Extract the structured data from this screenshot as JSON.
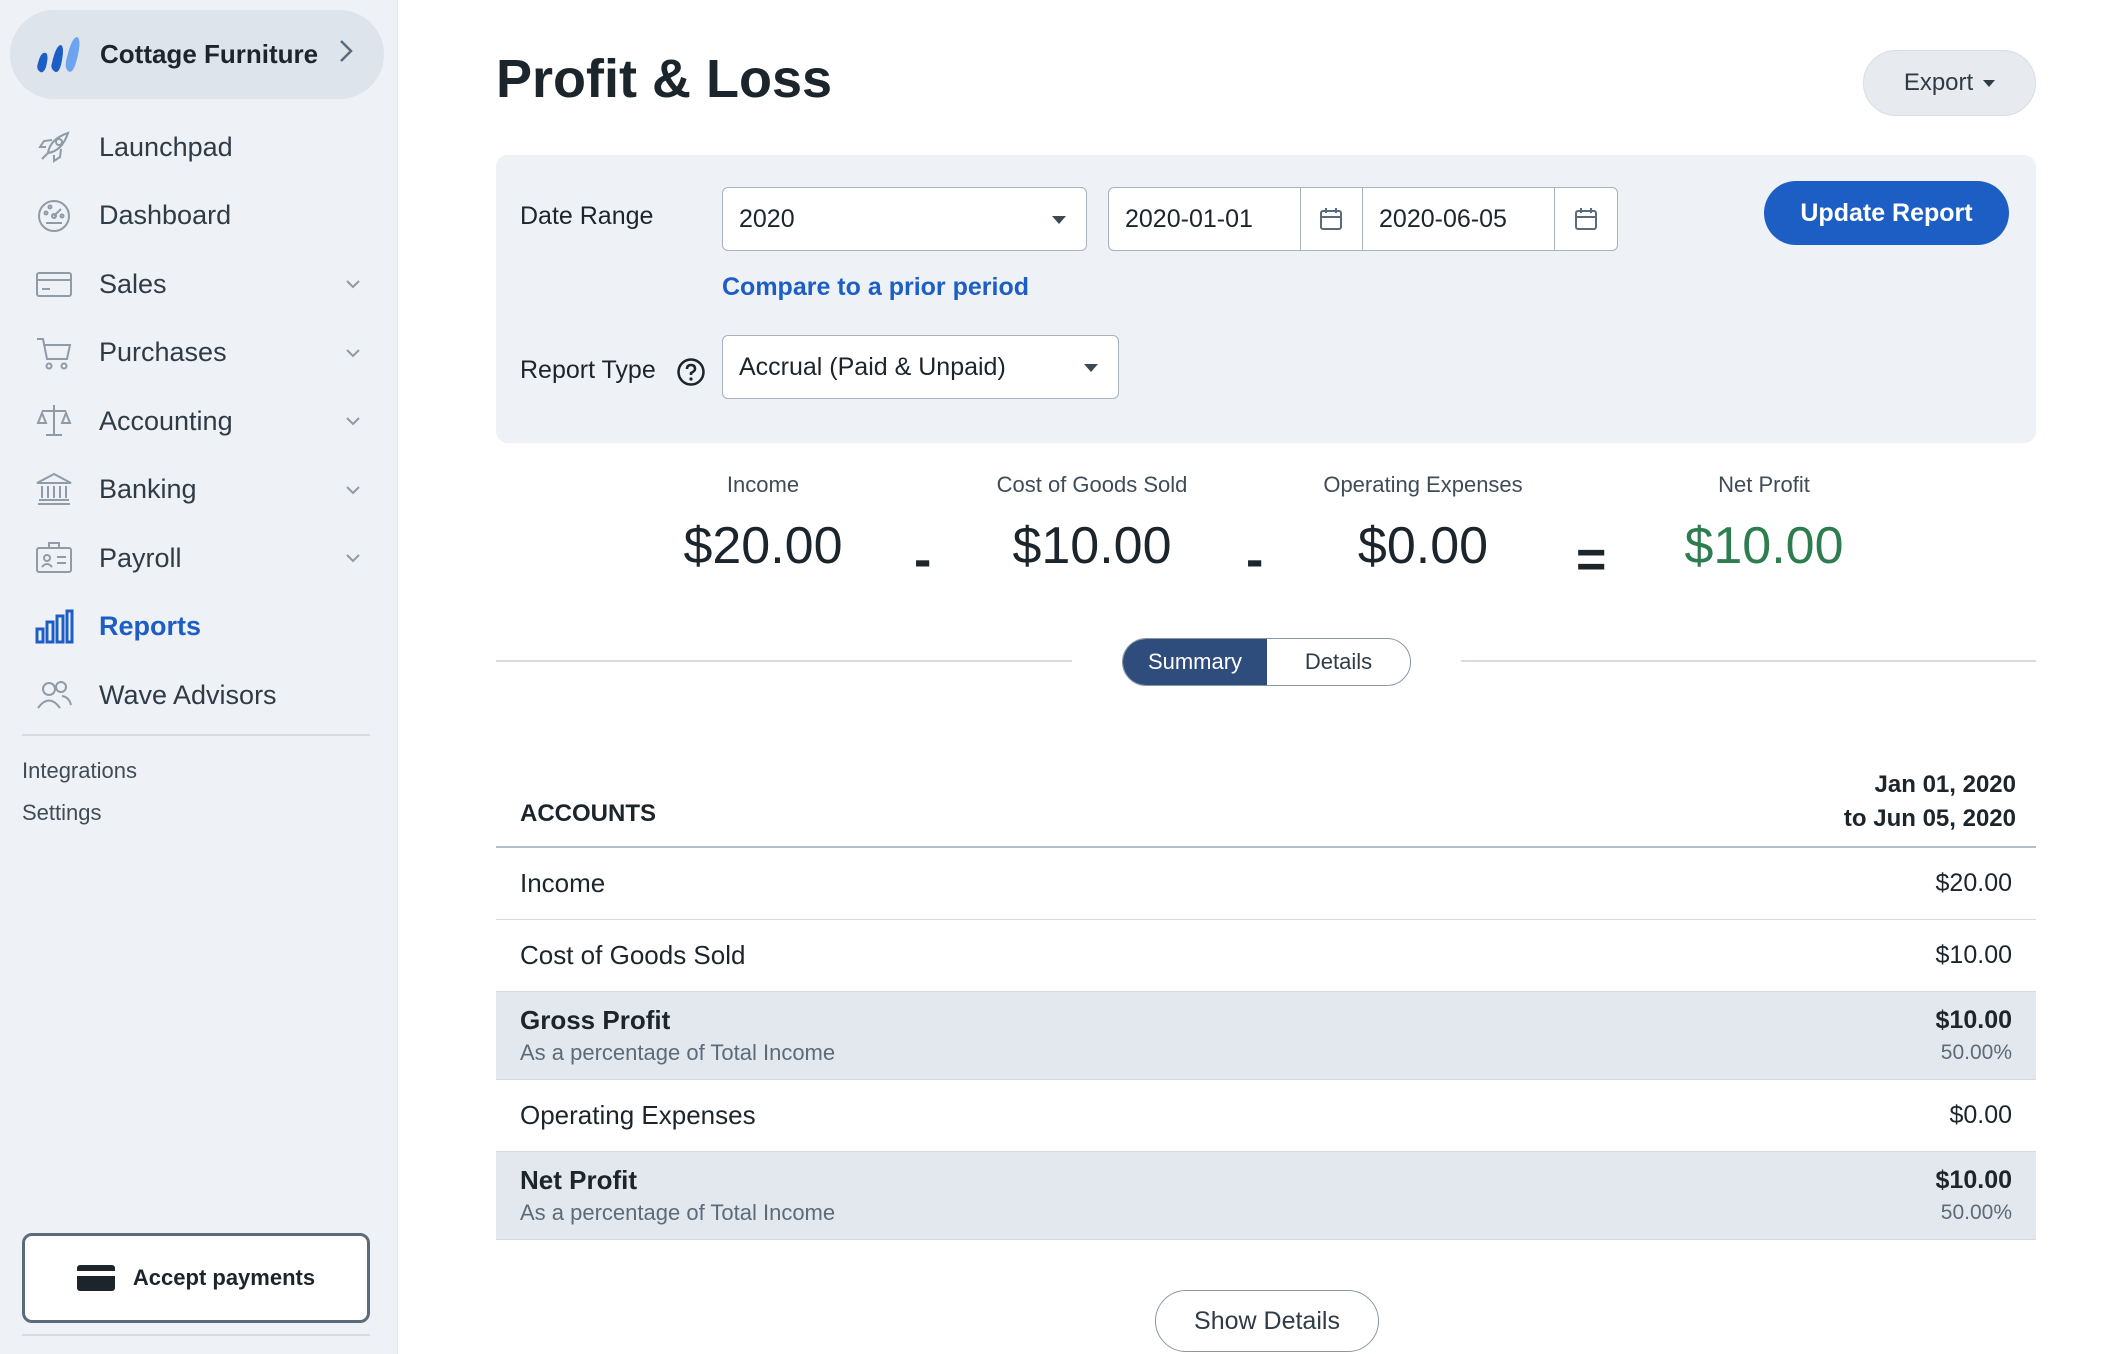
{
  "business": {
    "name": "Cottage Furniture"
  },
  "nav": {
    "items": [
      {
        "label": "Launchpad",
        "icon": "rocket-icon",
        "has_caret": false,
        "active": false
      },
      {
        "label": "Dashboard",
        "icon": "dashboard-icon",
        "has_caret": false,
        "active": false
      },
      {
        "label": "Sales",
        "icon": "sales-card-icon",
        "has_caret": true,
        "active": false
      },
      {
        "label": "Purchases",
        "icon": "cart-icon",
        "has_caret": true,
        "active": false
      },
      {
        "label": "Accounting",
        "icon": "scale-icon",
        "has_caret": true,
        "active": false
      },
      {
        "label": "Banking",
        "icon": "bank-icon",
        "has_caret": true,
        "active": false
      },
      {
        "label": "Payroll",
        "icon": "payroll-icon",
        "has_caret": true,
        "active": false
      },
      {
        "label": "Reports",
        "icon": "bar-chart-icon",
        "has_caret": false,
        "active": true
      },
      {
        "label": "Wave Advisors",
        "icon": "advisors-icon",
        "has_caret": false,
        "active": false
      }
    ],
    "sub_links": [
      "Integrations",
      "Settings"
    ],
    "accept_payments": "Accept payments"
  },
  "page": {
    "title": "Profit & Loss",
    "export_label": "Export"
  },
  "filters": {
    "date_range_label": "Date Range",
    "date_range_value": "2020",
    "start_date": "2020-01-01",
    "end_date": "2020-06-05",
    "compare_link": "Compare to a prior period",
    "report_type_label": "Report Type",
    "report_type_value": "Accrual (Paid & Unpaid)",
    "update_button": "Update Report"
  },
  "summary": {
    "income_label": "Income",
    "income_value": "$20.00",
    "cogs_label": "Cost of Goods Sold",
    "cogs_value": "$10.00",
    "opex_label": "Operating Expenses",
    "opex_value": "$0.00",
    "net_label": "Net Profit",
    "net_value": "$10.00",
    "minus": "-",
    "equals": "="
  },
  "view_toggle": {
    "summary": "Summary",
    "details": "Details",
    "selected": "Summary"
  },
  "table": {
    "accounts_header": "ACCOUNTS",
    "period_line1": "Jan 01, 2020",
    "period_line2": "to Jun 05, 2020",
    "rows": [
      {
        "title": "Income",
        "value": "$20.00"
      },
      {
        "title": "Cost of Goods Sold",
        "value": "$10.00"
      },
      {
        "title": "Gross Profit",
        "subtitle": "As a percentage of Total Income",
        "value": "$10.00",
        "pct": "50.00%"
      },
      {
        "title": "Operating Expenses",
        "value": "$0.00"
      },
      {
        "title": "Net Profit",
        "subtitle": "As a percentage of Total Income",
        "value": "$10.00",
        "pct": "50.00%"
      }
    ]
  },
  "show_details": "Show Details",
  "colors": {
    "brand_blue": "#1d5ec4",
    "positive_green": "#2e7d4f",
    "sidebar_bg": "#eef1f5"
  }
}
